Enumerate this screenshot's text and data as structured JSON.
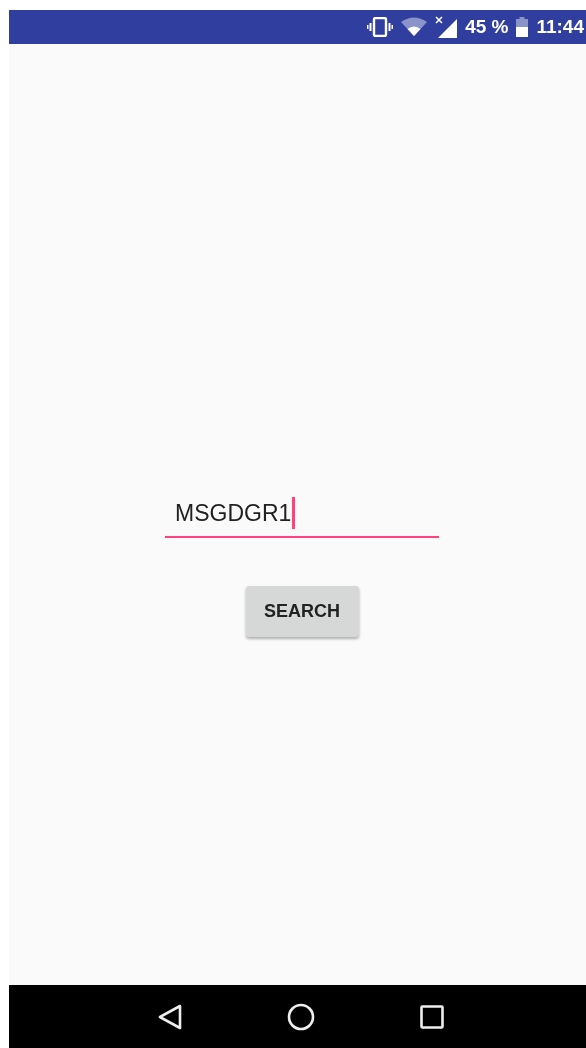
{
  "status_bar": {
    "battery": "45 %",
    "time": "11:44"
  },
  "search_field": {
    "value": "MSGDGR1",
    "focused": true
  },
  "search_button": {
    "label": "SEARCH"
  }
}
